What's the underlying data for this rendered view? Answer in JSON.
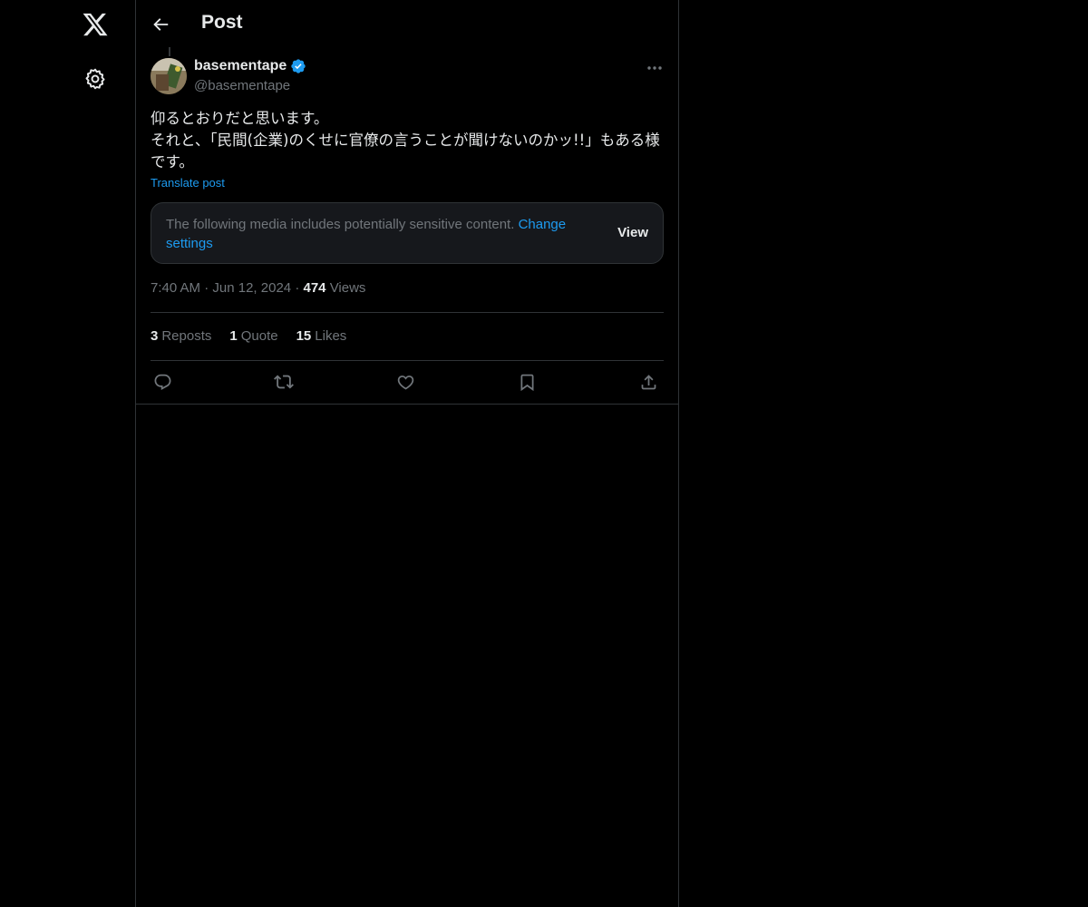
{
  "header": {
    "title": "Post"
  },
  "post": {
    "author": {
      "name": "basementape",
      "handle": "@basementape"
    },
    "text_lines": [
      "仰るとおりだと思います。",
      "それと、「民間(企業)のくせに官僚の言うことが聞けないのかッ!!」もある様",
      "です。"
    ],
    "translate_label": "Translate post",
    "sensitive": {
      "message": "The following media includes potentially sensitive content.",
      "change_label": "Change",
      "settings_label": "settings",
      "view_label": "View"
    },
    "time": "7:40 AM",
    "date": "Jun 12, 2024",
    "views_count": "474",
    "views_label": "Views",
    "stats": {
      "reposts_count": "3",
      "reposts_label": "Reposts",
      "quotes_count": "1",
      "quotes_label": "Quote",
      "likes_count": "15",
      "likes_label": "Likes"
    }
  },
  "icons": {
    "logo": "x-logo-icon",
    "settings": "gear-icon",
    "back": "arrow-left-icon",
    "more": "more-horizontal-icon",
    "verified": "verified-badge-icon",
    "reply": "reply-icon",
    "repost": "repost-icon",
    "like": "heart-icon",
    "bookmark": "bookmark-icon",
    "share": "share-icon"
  },
  "colors": {
    "background": "#000000",
    "accent": "#1d9bf0",
    "text": "#e7e9ea",
    "muted": "#71767b",
    "border": "#2f3336"
  }
}
